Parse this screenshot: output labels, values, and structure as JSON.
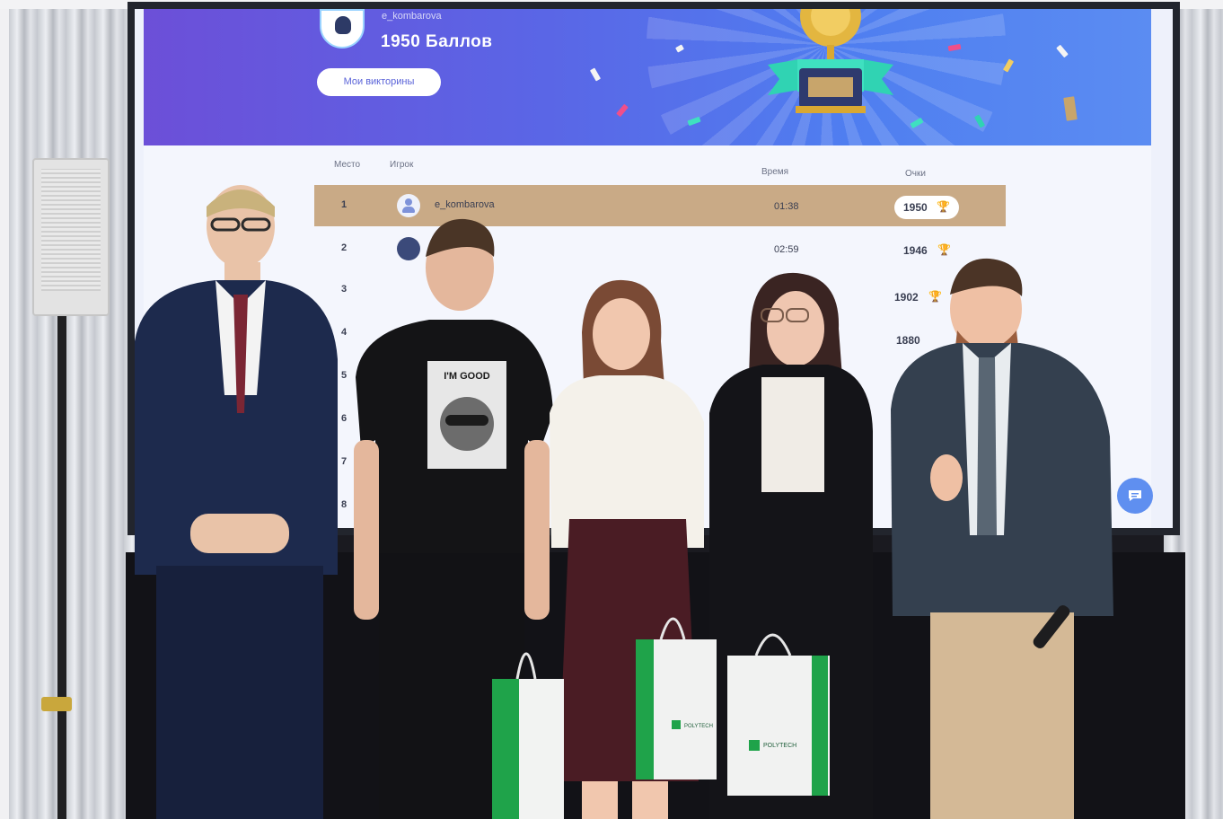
{
  "screen": {
    "header": {
      "username": "e_kombarova",
      "score": "1950 Баллов",
      "quiz_button": "Мои викторины"
    },
    "leaderboard": {
      "columns": {
        "place": "Место",
        "player": "Игрок",
        "time": "Время",
        "points": "Очки"
      },
      "rows": [
        {
          "rank": "1",
          "player": "e_kombarova",
          "time": "01:38",
          "points": "1950"
        },
        {
          "rank": "2",
          "player": "",
          "time": "02:59",
          "points": "1946"
        },
        {
          "rank": "3",
          "player": "",
          "time": "",
          "points": "1902"
        },
        {
          "rank": "4",
          "player": "",
          "time": "",
          "points": "1880"
        },
        {
          "rank": "5",
          "player": "",
          "time": "",
          "points": ""
        },
        {
          "rank": "6",
          "player": "",
          "time": "",
          "points": ""
        },
        {
          "rank": "7",
          "player": "",
          "time": "",
          "points": ""
        },
        {
          "rank": "8",
          "player": "",
          "time": "",
          "points": ""
        }
      ]
    },
    "chat_icon": "chat-bubble-icon",
    "trophy_icon": "trophy-icon"
  },
  "tshirt_text": "I'M GOOD",
  "bag_brand": "POLYTECH",
  "colors": {
    "banner_start": "#6c4fd8",
    "banner_end": "#5b8cf2",
    "highlight_row": "#c9aa86",
    "accent_green": "#1fa34a",
    "chat_button": "#5f8ff0"
  }
}
